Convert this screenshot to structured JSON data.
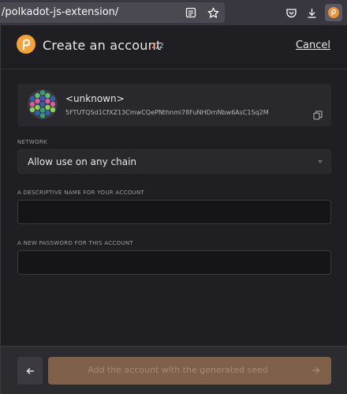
{
  "browser": {
    "url": "/polkadot-js-extension/"
  },
  "header": {
    "title": "Create an account",
    "step_current": "2",
    "step_total": "/2",
    "cancel_label": "Cancel"
  },
  "account": {
    "name": "<unknown>",
    "address": "5FTUTQSd1CfXZ13CmwCQePNthnmi78FuNHDmNbw6AsC1Sq2M"
  },
  "network": {
    "label": "NETWORK",
    "selected": "Allow use on any chain"
  },
  "name_field": {
    "label": "A DESCRIPTIVE NAME FOR YOUR ACCOUNT",
    "value": ""
  },
  "password_field": {
    "label": "A NEW PASSWORD FOR THIS ACCOUNT",
    "value": ""
  },
  "footer": {
    "next_label": "Add the account with the generated seed"
  },
  "colors": {
    "accent": "#ff8a3d",
    "logo": "#f4a23a",
    "next_button": "#7f6048"
  },
  "icons": {
    "reader": "reader-view-icon",
    "bookmark": "bookmark-star-icon",
    "pocket": "pocket-icon",
    "download": "download-icon",
    "extension": "polkadot-extension-icon",
    "copy": "copy-icon",
    "back": "arrow-left-icon",
    "next": "arrow-right-icon"
  }
}
